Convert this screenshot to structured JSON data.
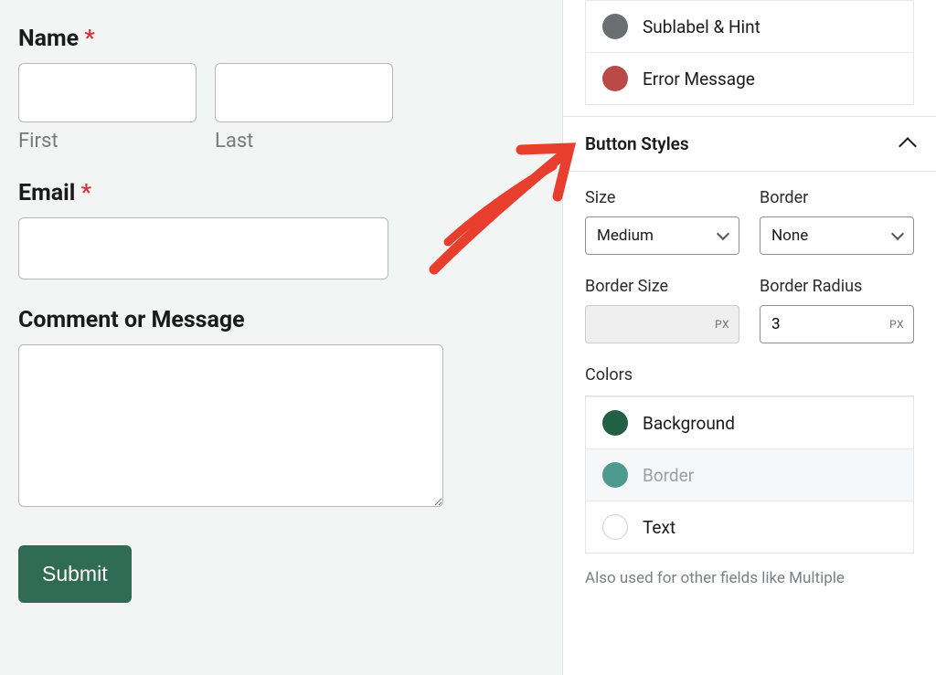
{
  "form": {
    "name": {
      "label": "Name",
      "required": "*",
      "first_sub": "First",
      "last_sub": "Last"
    },
    "email": {
      "label": "Email",
      "required": "*"
    },
    "comment": {
      "label": "Comment or Message"
    },
    "submit": "Submit"
  },
  "sidebar": {
    "top_options": [
      {
        "label": "Sublabel & Hint",
        "swatch": "gray"
      },
      {
        "label": "Error Message",
        "swatch": "red"
      }
    ],
    "section_title": "Button Styles",
    "size": {
      "label": "Size",
      "value": "Medium"
    },
    "border": {
      "label": "Border",
      "value": "None"
    },
    "border_size": {
      "label": "Border Size",
      "unit": "PX",
      "value": ""
    },
    "border_radius": {
      "label": "Border Radius",
      "unit": "PX",
      "value": "3"
    },
    "colors_heading": "Colors",
    "colors": [
      {
        "label": "Background",
        "swatch": "dgreen",
        "muted": false
      },
      {
        "label": "Border",
        "swatch": "teal",
        "muted": true
      },
      {
        "label": "Text",
        "swatch": "white",
        "muted": false
      }
    ],
    "help": "Also used for other fields like Multiple"
  }
}
